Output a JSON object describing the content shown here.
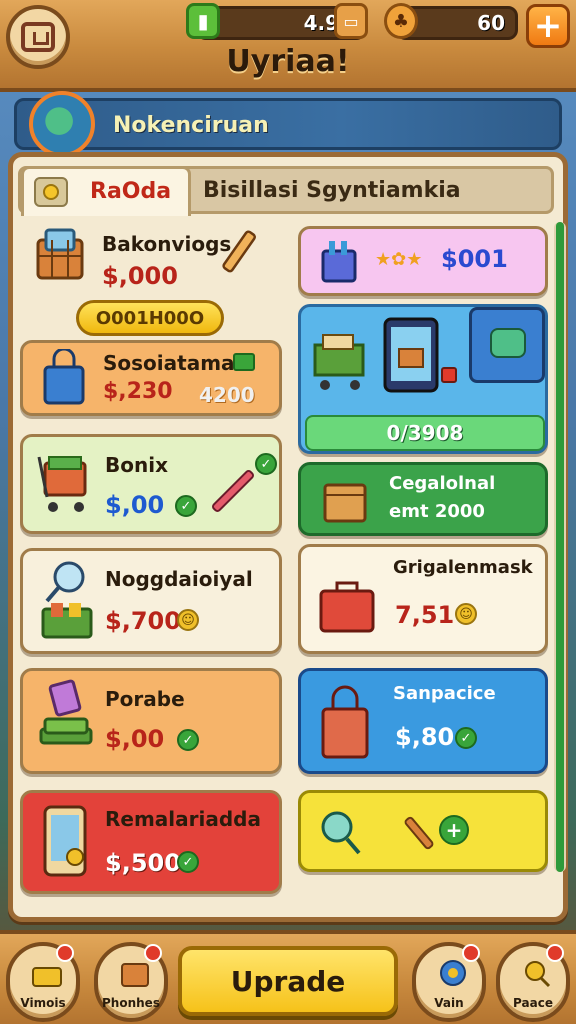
{
  "header": {
    "title": "Uyriaa!",
    "currency_1": "4.90",
    "currency_2": "60",
    "plus_label": "+"
  },
  "banner": {
    "label": "Nokenciruan"
  },
  "tabs": [
    {
      "label": "RaOda"
    },
    {
      "label": "Bisillasi Sgyntiamkia"
    }
  ],
  "ribbon": {
    "label": "O001H00O"
  },
  "left_cards": [
    {
      "name": "Bakonviogs",
      "price": "$,000",
      "color": "#f4ead2"
    },
    {
      "name": "Sosoiatamal",
      "price": "$,230",
      "extra": "4200",
      "color": "#f6b46a"
    },
    {
      "name": "Bonix",
      "price": "$,00",
      "color": "#e4f2c4"
    },
    {
      "name": "Noggdaioiyal",
      "price": "$,700",
      "color": "#f8f0dc"
    },
    {
      "name": "Porabe",
      "price": "$,00",
      "color": "#f6b46a"
    },
    {
      "name": "Remalariadda",
      "price": "$,500",
      "color": "#e3423a"
    }
  ],
  "right_cards": {
    "top_price": "$001",
    "progress": "0/3908",
    "green": {
      "name": "Cegalolnal",
      "sub": "emt 2000"
    },
    "white": {
      "name": "Grigalenmask",
      "price": "7,51"
    },
    "blue": {
      "name": "Sanpacice",
      "price": "$,80"
    }
  },
  "bottom_nav": [
    {
      "label": "Vimois"
    },
    {
      "label": "Phonhes"
    },
    {
      "label": "Vain"
    },
    {
      "label": "Paace"
    }
  ],
  "upgrade_label": "Uprade",
  "colors": {
    "accent": "#f6c21a",
    "wood": "#c98a3e",
    "price_red": "#b8241a"
  }
}
